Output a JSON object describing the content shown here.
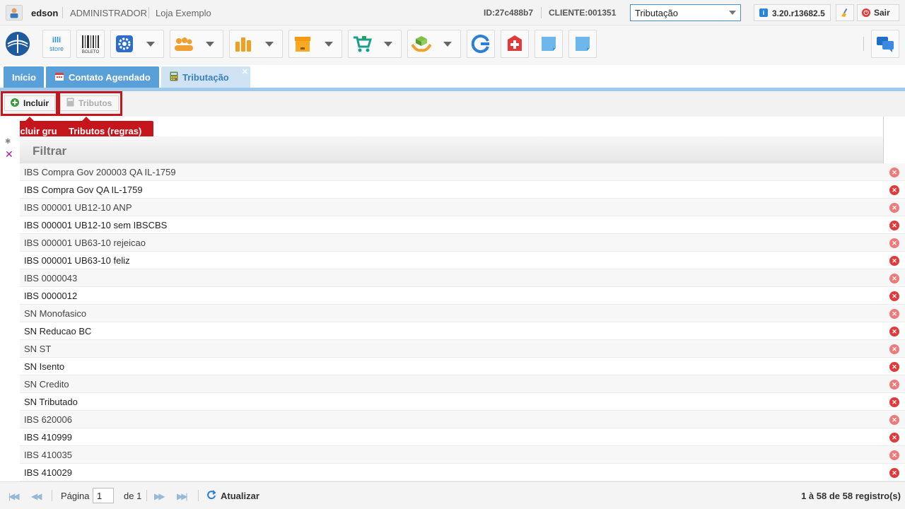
{
  "header": {
    "user": "edson",
    "role": "ADMINISTRADOR",
    "store": "Loja Exemplo",
    "session_id": "ID:27c488b7",
    "client": "CLIENTE:001351",
    "module_select": "Tributação",
    "version": "3.20.r13682.5",
    "logout": "Sair"
  },
  "toolbar_icons": [
    "illi-store-icon",
    "boleto-icon",
    "settings-icon",
    "people-icon",
    "chart-icon",
    "box-icon",
    "cart-icon",
    "handshake-icon",
    "refresh-g-icon",
    "first-aid-icon",
    "note-icon",
    "note-icon",
    "chat-icon"
  ],
  "tabs": [
    {
      "label": "Início"
    },
    {
      "label": "Contato Agendado"
    },
    {
      "label": "Tributação"
    }
  ],
  "actions": {
    "add": "Incluir",
    "tributos": "Tributos",
    "tip_add": "Incluir gru",
    "tip_tributos": "Tributos (regras)"
  },
  "filter_label": "Filtrar",
  "rows": [
    "IBS Compra Gov 200003 QA IL-1759",
    "IBS Compra Gov QA IL-1759",
    "IBS 000001 UB12-10 ANP",
    "IBS 000001 UB12-10 sem IBSCBS",
    "IBS 000001 UB63-10 rejeicao",
    "IBS 000001 UB63-10 feliz",
    "IBS 0000043",
    "IBS 0000012",
    "SN Monofasico",
    "SN Reducao BC",
    "SN ST",
    "SN Isento",
    "SN Credito",
    "SN Tributado",
    "IBS 620006",
    "IBS 410999",
    "IBS 410035",
    "IBS 410029"
  ],
  "pager": {
    "page_label": "Página",
    "page_value": "1",
    "of_label": "de 1",
    "refresh": "Atualizar",
    "summary": "1 à 58 de 58 registro(s)"
  }
}
